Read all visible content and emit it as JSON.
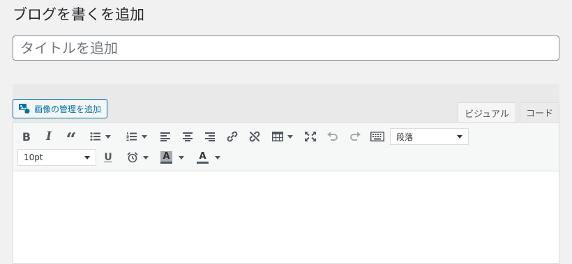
{
  "page": {
    "title": "ブログを書くを追加"
  },
  "title_field": {
    "placeholder": "タイトルを追加",
    "value": ""
  },
  "media": {
    "button_label": "画像の管理を追加"
  },
  "tabs": [
    {
      "label": "ビジュアル",
      "active": true
    },
    {
      "label": "コード",
      "active": false
    }
  ],
  "toolbar": {
    "row1": [
      {
        "icon": "bold-icon",
        "glyph": "B"
      },
      {
        "icon": "italic-icon",
        "glyph": "I"
      },
      {
        "icon": "blockquote-icon",
        "glyph": "“"
      },
      {
        "icon": "bullet-list-icon"
      },
      {
        "icon": "numbered-list-icon"
      },
      {
        "icon": "align-left-icon"
      },
      {
        "icon": "align-center-icon"
      },
      {
        "icon": "align-right-icon"
      },
      {
        "icon": "link-icon"
      },
      {
        "icon": "unlink-icon"
      },
      {
        "icon": "table-icon"
      },
      {
        "icon": "fullscreen-icon"
      },
      {
        "icon": "undo-icon"
      },
      {
        "icon": "redo-icon"
      },
      {
        "icon": "keyboard-icon"
      }
    ],
    "format_select": {
      "value": "段落"
    },
    "row2": [
      {
        "icon": "underline-icon",
        "glyph": "U"
      },
      {
        "icon": "alarm-clock-icon"
      },
      {
        "icon": "background-color-icon",
        "glyph": "A"
      },
      {
        "icon": "text-color-icon",
        "glyph": "A"
      }
    ],
    "font_size_select": {
      "value": "10pt"
    }
  },
  "colors": {
    "accent": "#0071a1",
    "background": "#f1f1f1",
    "toolbar_background": "#f6f7f7",
    "icon": "#50575e",
    "disabled_icon": "#a7aaad"
  }
}
